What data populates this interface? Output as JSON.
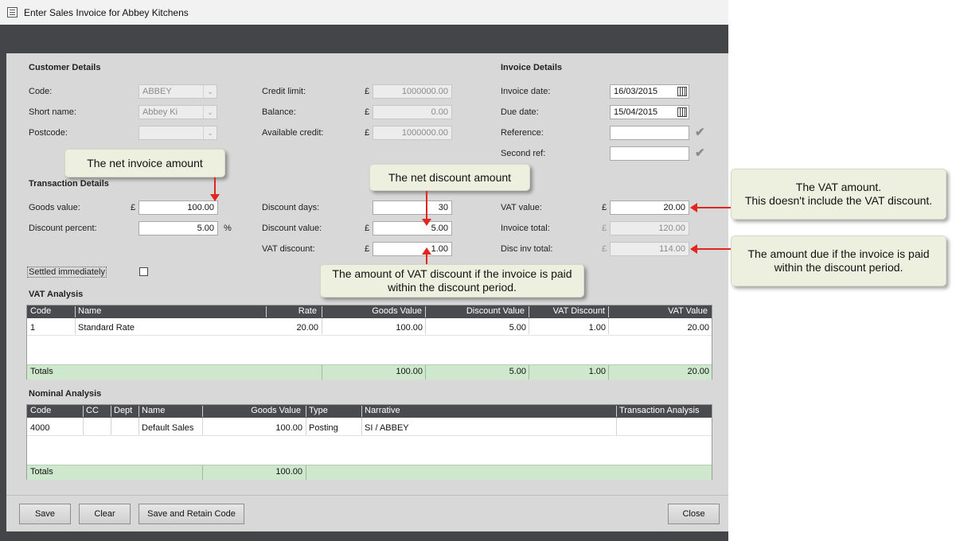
{
  "window": {
    "title": "Enter Sales Invoice for Abbey Kitchens"
  },
  "customer": {
    "heading": "Customer Details",
    "code_label": "Code:",
    "code_value": "ABBEY",
    "short_name_label": "Short name:",
    "short_name_value": "Abbey Ki",
    "postcode_label": "Postcode:",
    "postcode_value": "",
    "credit_limit_label": "Credit limit:",
    "credit_limit_value": "1000000.00",
    "balance_label": "Balance:",
    "balance_value": "0.00",
    "available_credit_label": "Available credit:",
    "available_credit_value": "1000000.00",
    "currency": "£"
  },
  "invoice": {
    "heading": "Invoice Details",
    "invoice_date_label": "Invoice date:",
    "invoice_date_value": "16/03/2015",
    "due_date_label": "Due date:",
    "due_date_value": "15/04/2015",
    "reference_label": "Reference:",
    "reference_value": "",
    "second_ref_label": "Second ref:",
    "second_ref_value": ""
  },
  "transaction": {
    "heading": "Transaction Details",
    "goods_value_label": "Goods value:",
    "goods_value": "100.00",
    "discount_percent_label": "Discount percent:",
    "discount_percent": "5.00",
    "percent_sign": "%",
    "discount_days_label": "Discount days:",
    "discount_days": "30",
    "discount_value_label": "Discount value:",
    "discount_value": "5.00",
    "vat_discount_label": "VAT discount:",
    "vat_discount": "1.00",
    "vat_value_label": "VAT value:",
    "vat_value": "20.00",
    "invoice_total_label": "Invoice total:",
    "invoice_total": "120.00",
    "disc_inv_total_label": "Disc inv total:",
    "disc_inv_total": "114.00",
    "settled_label": "Settled immediately"
  },
  "vat_analysis": {
    "heading": "VAT Analysis",
    "columns": [
      "Code",
      "Name",
      "Rate",
      "Goods Value",
      "Discount Value",
      "VAT Discount",
      "VAT Value"
    ],
    "rows": [
      {
        "code": "1",
        "name": "Standard Rate",
        "rate": "20.00",
        "goods": "100.00",
        "discount": "5.00",
        "vat_discount": "1.00",
        "vat": "20.00"
      }
    ],
    "totals_label": "Totals",
    "totals": {
      "goods": "100.00",
      "discount": "5.00",
      "vat_discount": "1.00",
      "vat": "20.00"
    }
  },
  "nominal_analysis": {
    "heading": "Nominal Analysis",
    "columns": [
      "Code",
      "CC",
      "Dept",
      "Name",
      "Goods Value",
      "Type",
      "Narrative",
      "Transaction Analysis"
    ],
    "rows": [
      {
        "code": "4000",
        "cc": "",
        "dept": "",
        "name": "Default Sales",
        "goods": "100.00",
        "type": "Posting",
        "narrative": "SI / ABBEY",
        "analysis": ""
      }
    ],
    "totals_label": "Totals",
    "totals": {
      "goods": "100.00"
    }
  },
  "buttons": {
    "save": "Save",
    "clear": "Clear",
    "save_retain": "Save and Retain Code",
    "close": "Close"
  },
  "callouts": {
    "net_invoice": "The net invoice amount",
    "net_discount": "The net discount amount",
    "vat_discount_line1": "The amount of VAT discount if the invoice is paid",
    "vat_discount_line2": "within the discount period.",
    "vat_amount_line1": "The VAT amount.",
    "vat_amount_line2": "This doesn't include the VAT discount.",
    "amount_due_line1": "The amount due if the invoice is paid",
    "amount_due_line2": "within the discount period."
  },
  "colors": {
    "arrow": "#e0261f",
    "header_bg": "#4a4b4e",
    "totals_bg": "#cde8cc",
    "callout_bg": "#eef0df"
  },
  "icons": [
    "window-form-icon",
    "calendar-icon",
    "checkmark-icon",
    "dropdown-chevron-icon"
  ]
}
